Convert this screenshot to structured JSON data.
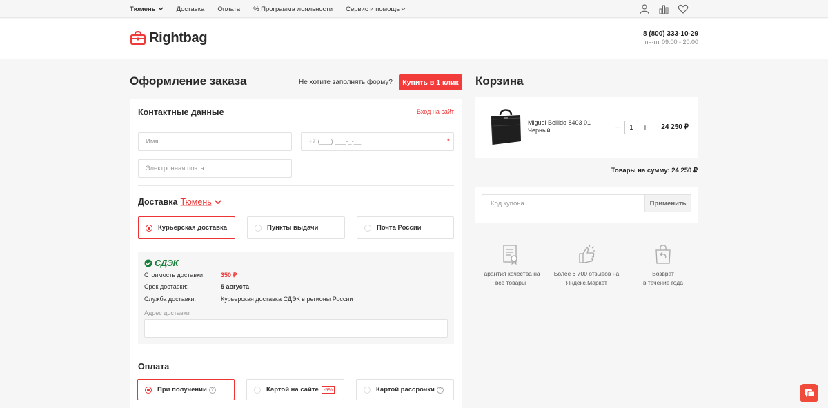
{
  "topbar": {
    "city": "Тюмень",
    "nav": [
      "Доставка",
      "Оплата",
      "% Программа лояльности"
    ],
    "service": "Сервис и помощь",
    "icons": [
      "user-icon",
      "compare-icon",
      "heart-icon"
    ]
  },
  "header": {
    "logo": "Rightbag",
    "phone": "8 (800) 333-10-29",
    "hours": "пн-пт 09:00 - 20:00"
  },
  "checkout": {
    "title": "Оформление заказа",
    "no_form_text": "Не хотите заполнять форму?",
    "buy_one_click": "Купить в 1 клик",
    "contact": {
      "title": "Контактные данные",
      "login_link": "Вход на сайт",
      "name_placeholder": "Имя",
      "phone_placeholder": "+7 (___) ___-_-__",
      "email_placeholder": "Электронная почта",
      "required_mark": "*"
    },
    "delivery": {
      "title": "Доставка",
      "city": "Тюмень",
      "options": [
        "Курьерская доставка",
        "Пункты выдачи",
        "Почта России"
      ],
      "selected": 0,
      "provider": "СДЭК",
      "rows": [
        {
          "label": "Стоимость доставки:",
          "value": "350 ₽"
        },
        {
          "label": "Срок доставки:",
          "value": "5 августа"
        },
        {
          "label": "Служба доставки:",
          "value": "Курьерская доставка СДЭК в регионы России"
        }
      ],
      "address_label": "Адрес доставки"
    },
    "payment": {
      "title": "Оплата",
      "options": [
        "При получении",
        "Картой на сайте",
        "Картой рассрочки"
      ],
      "discount_badge": "-5%",
      "help_mark": "?",
      "selected": 0
    }
  },
  "cart": {
    "title": "Корзина",
    "item": {
      "name_line1": "Miguel Bellido 8403 01",
      "name_line2": "Черный",
      "qty": "1",
      "minus": "−",
      "plus": "+",
      "price": "24 250 ₽"
    },
    "total": "Товары на сумму: 24 250 ₽",
    "coupon_placeholder": "Код купона",
    "apply": "Применить",
    "features": [
      {
        "icon": "certificate-icon",
        "text": "Гарантия качества на\nвсе товары"
      },
      {
        "icon": "thumbs-up-icon",
        "text": "Более 6 700 отзывов на\nЯндекс.Маркет"
      },
      {
        "icon": "return-bag-icon",
        "text": "Возврат\nв течение года"
      }
    ]
  },
  "colors": {
    "accent": "#f23b3b",
    "cdek_green": "#1a7f3a"
  }
}
